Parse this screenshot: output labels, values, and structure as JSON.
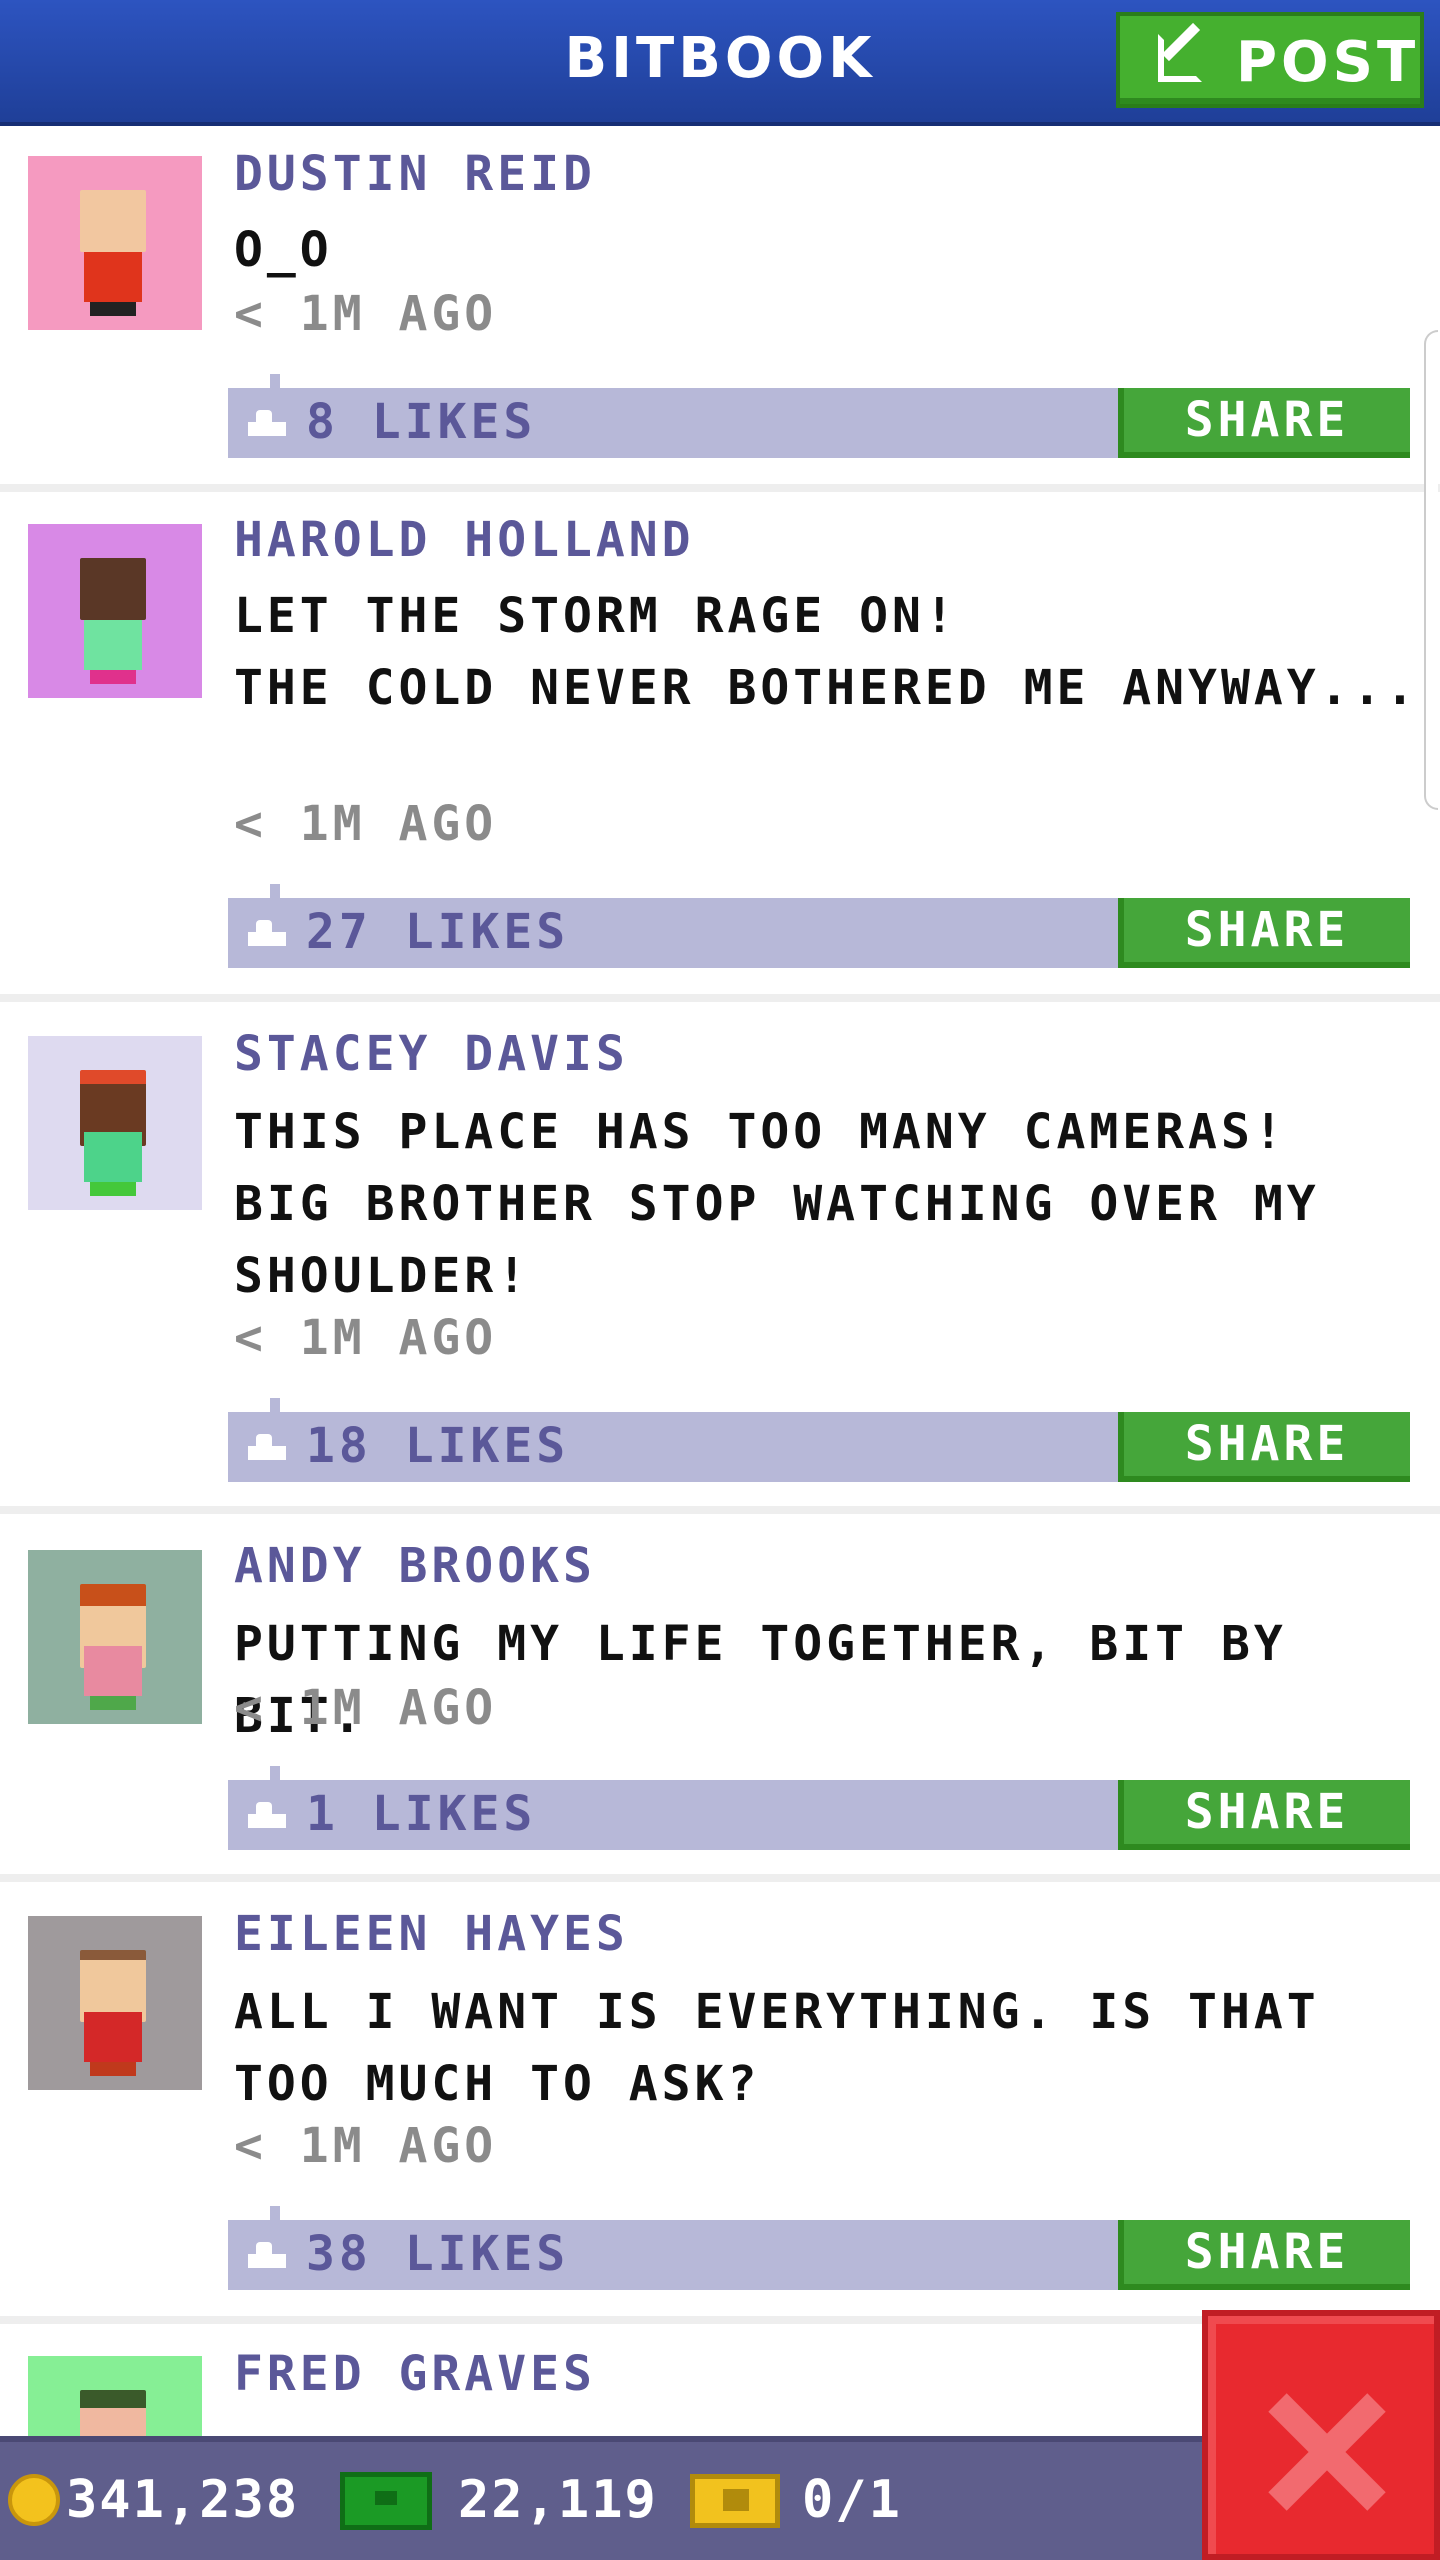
{
  "header": {
    "title": "BITBOOK",
    "post_label": "POST"
  },
  "feed": {
    "posts": [
      {
        "author": "DUSTIN REID",
        "message": "O_O",
        "time": "< 1M AGO",
        "likes": "8 LIKES",
        "share": "SHARE",
        "avatar_bg": "#f59ac0"
      },
      {
        "author": "HAROLD HOLLAND",
        "message": "LET THE STORM RAGE ON!\nTHE COLD NEVER BOTHERED ME ANYWAY...",
        "time": "< 1M AGO",
        "likes": "27 LIKES",
        "share": "SHARE",
        "avatar_bg": "#d889e6"
      },
      {
        "author": "STACEY DAVIS",
        "message": "THIS PLACE HAS TOO MANY CAMERAS!\nBIG BROTHER STOP WATCHING OVER MY SHOULDER!",
        "time": "< 1M AGO",
        "likes": "18 LIKES",
        "share": "SHARE",
        "avatar_bg": "#dedaf0"
      },
      {
        "author": "ANDY BROOKS",
        "message": "PUTTING MY LIFE TOGETHER, BIT BY BIT.",
        "time": "< 1M AGO",
        "likes": "1 LIKES",
        "share": "SHARE",
        "avatar_bg": "#8fb0a0"
      },
      {
        "author": "EILEEN HAYES",
        "message": "ALL I WANT IS EVERYTHING. IS THAT TOO MUCH TO ASK?",
        "time": "< 1M AGO",
        "likes": "38 LIKES",
        "share": "SHARE",
        "avatar_bg": "#9f9a9c"
      },
      {
        "author": "FRED GRAVES",
        "avatar_bg": "#86ef95"
      }
    ]
  },
  "status": {
    "coins": "341,238",
    "bux": "22,119",
    "tickets": "0/1"
  },
  "colors": {
    "header": "#2d54c0",
    "accent_green": "#45b02f",
    "author_purple": "#5b5899",
    "likes_bar": "#b7b8d8",
    "close_red": "#e8292f"
  },
  "icons": {
    "post": "edit-icon",
    "like": "thumbs-up-icon",
    "coin": "coin-icon",
    "bux": "bux-icon",
    "ticket": "ticket-icon",
    "close": "close-icon"
  }
}
